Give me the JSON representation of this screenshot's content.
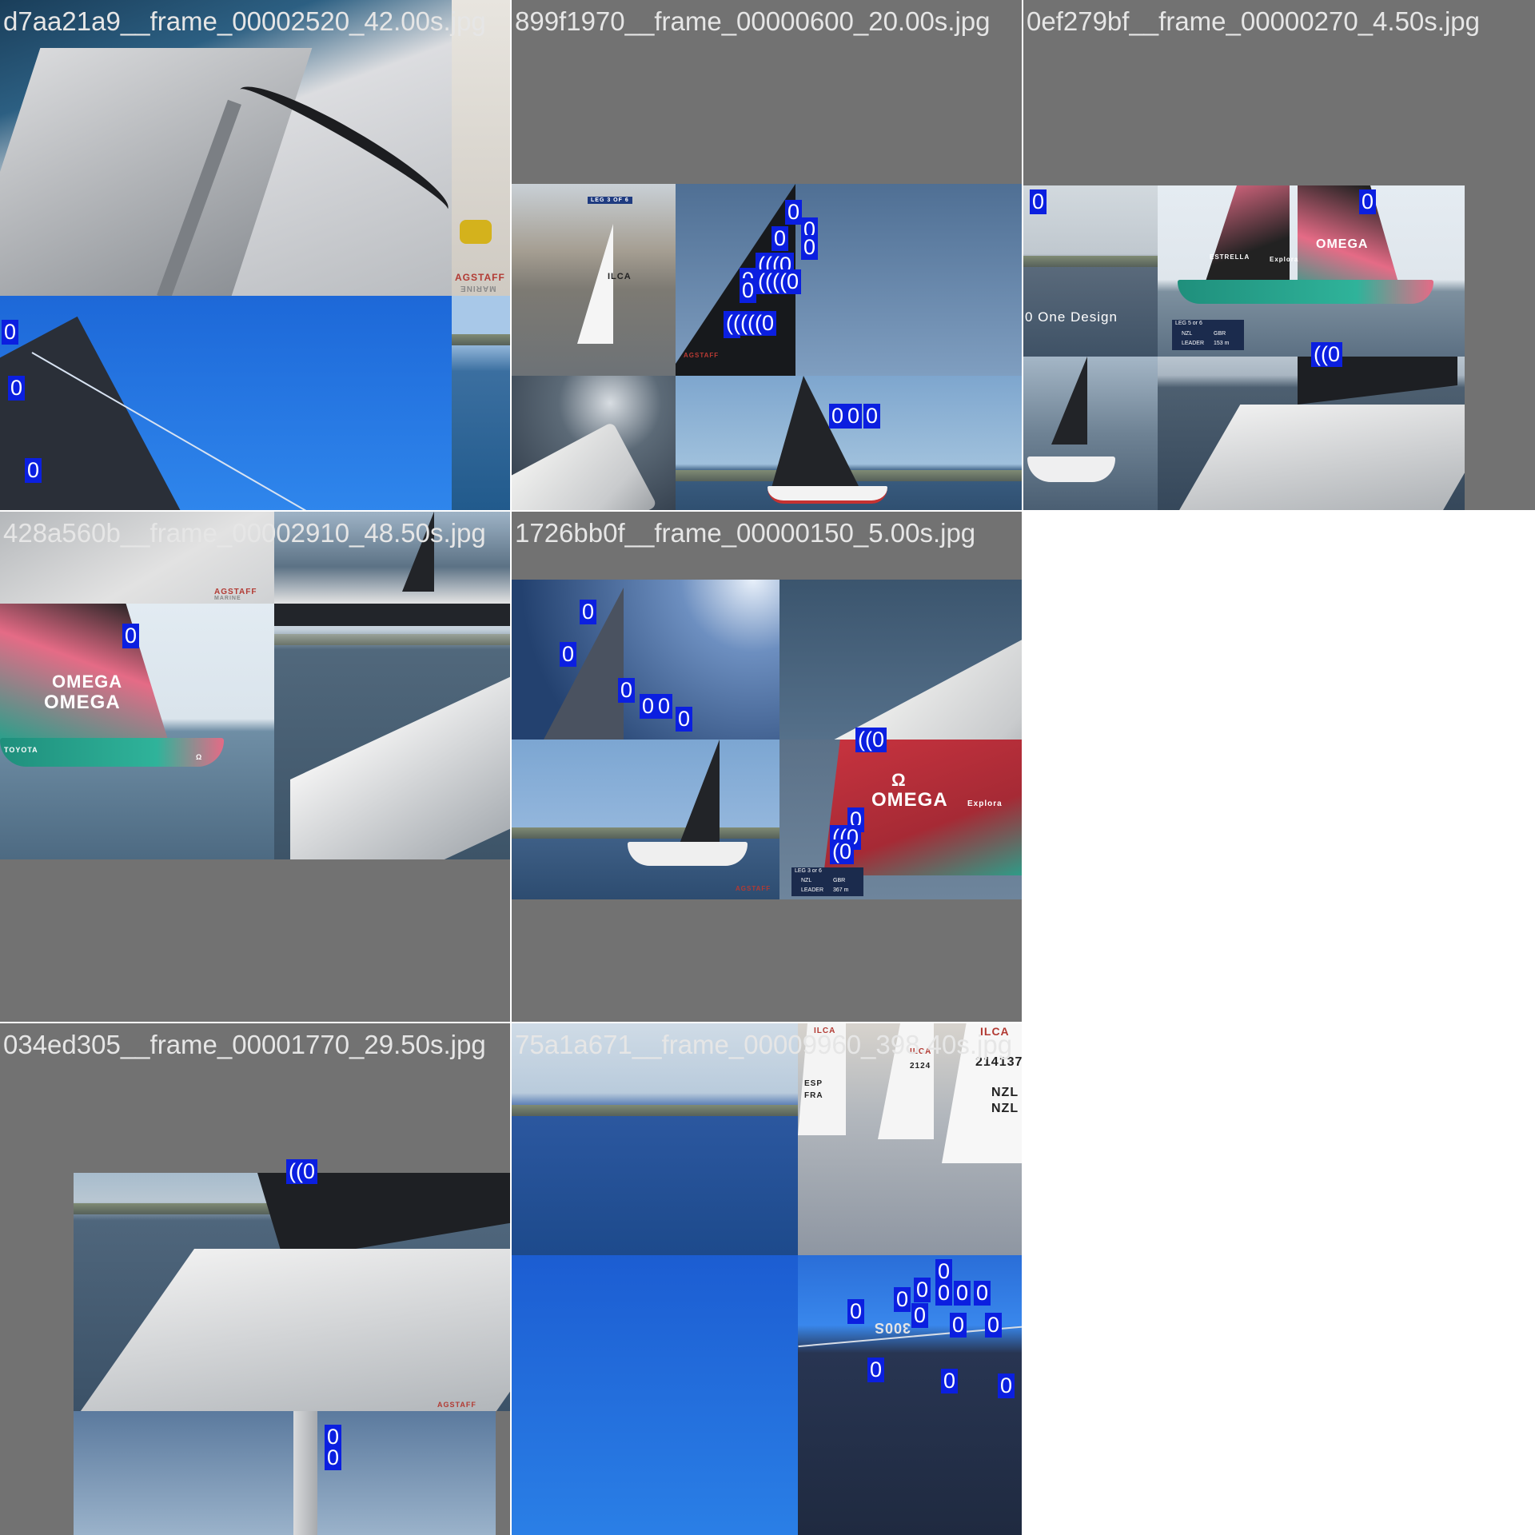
{
  "grid": {
    "background": "#727272",
    "label_color": "#e6e6e6",
    "box_color": "#0b1fe0"
  },
  "cells": [
    {
      "filename": "d7aa21a9__frame_00002520_42.00s.jpg",
      "labels": [
        "0",
        "0",
        "0"
      ],
      "overlay_text": [
        "AGSTAFF",
        "MARINE"
      ]
    },
    {
      "filename": "899f1970__frame_00000600_20.00s.jpg",
      "labels": [
        "0",
        "0",
        "0",
        "0",
        "(((0",
        "0",
        "((((0",
        "0",
        "0",
        "(((((0",
        "0",
        "0",
        "0"
      ],
      "overlay_text": [
        "LEG 3 OF 6",
        "ILCA",
        "AGSTAFF"
      ]
    },
    {
      "filename": "0ef279bf__frame_00000270_4.50s.jpg",
      "labels": [
        "0",
        "0",
        "((0"
      ],
      "overlay_text": [
        "0 One Design",
        "OMEGA",
        "ESTRELLA",
        "Explora",
        "LEG 5 or 6",
        "NZL",
        "GBR",
        "LEADER",
        "153 m"
      ]
    },
    {
      "filename": "428a560b__frame_00002910_48.50s.jpg",
      "labels": [
        "0"
      ],
      "overlay_text": [
        "AGSTAFF",
        "MARINE",
        "OMEGA",
        "Ω",
        "OMEGA",
        "TOYOTA"
      ]
    },
    {
      "filename": "1726bb0f__frame_00000150_5.00s.jpg",
      "labels": [
        "0",
        "0",
        "0",
        "0",
        "0",
        "0",
        "((0",
        "0",
        "((0",
        "(0"
      ],
      "overlay_text": [
        "OMEGA",
        "Ω",
        "Explora",
        "LEG 3 or 6",
        "NZL",
        "GBR",
        "LEADER",
        "367 m",
        "AGSTAFF"
      ]
    },
    {
      "filename": "034ed305__frame_00001770_29.50s.jpg",
      "labels": [
        "((0",
        "0",
        "0"
      ],
      "overlay_text": [
        "AGSTAFF"
      ]
    },
    {
      "filename": "75a1a671__frame_00009960_398.40s.jpg",
      "labels": [
        "0",
        "0",
        "0",
        "0",
        "0",
        "0",
        "0",
        "0",
        "0",
        "0",
        "0",
        "0",
        "0",
        "0"
      ],
      "overlay_text": [
        "ILCA",
        "214137",
        "NZL",
        "NZL",
        "ILCA",
        "2124",
        "ILCA",
        "ESP",
        "FRA",
        "300S"
      ]
    }
  ]
}
